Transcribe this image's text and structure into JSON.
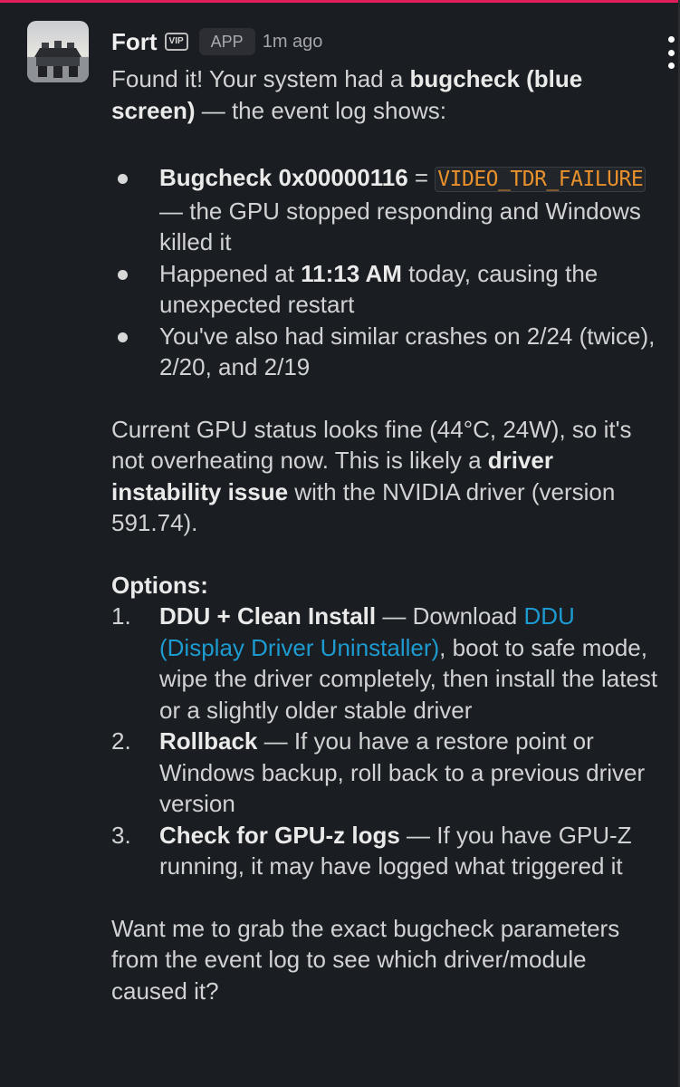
{
  "message": {
    "author": "Fort",
    "vip_badge": "VIP",
    "app_badge": "APP",
    "timestamp": "1m ago",
    "intro": {
      "prefix": "Found it! Your system had a ",
      "bold": "bugcheck (blue screen)",
      "suffix": " — the event log shows:"
    },
    "bullets": [
      {
        "bold": "Bugcheck 0x00000116",
        "text1": " = ",
        "code": "VIDEO_TDR_FAILURE",
        "text2": " — the GPU stopped responding and Windows killed it"
      },
      {
        "text1": "Happened at ",
        "bold": "11:13 AM",
        "text2": " today, causing the unexpected restart"
      },
      {
        "text": "You've also had similar crashes on 2/24 (twice), 2/20, and 2/19"
      }
    ],
    "status": {
      "text1": "Current GPU status looks fine (44°C, 24W), so it's not overheating now. This is likely a ",
      "bold": "driver instability issue",
      "text2": " with the NVIDIA driver (version 591.74)."
    },
    "options_heading": "Options:",
    "options": [
      {
        "number": "1.",
        "bold": "DDU + Clean Install",
        "text1": " — Download ",
        "link": "DDU (Display Driver Uninstaller)",
        "text2": ", boot to safe mode, wipe the driver completely, then install the latest or a slightly older stable driver"
      },
      {
        "number": "2.",
        "bold": "Rollback",
        "text1": " — If you have a restore point or Windows backup, roll back to a previous driver version"
      },
      {
        "number": "3.",
        "bold": "Check for GPU-z logs",
        "text1": " — If you have GPU-Z running, it may have logged what triggered it"
      }
    ],
    "closing": "Want me to grab the exact bugcheck parameters from the event log to see which driver/module caused it?"
  },
  "icons": {
    "avatar": "avatar-image",
    "menu": "more-vertical-icon"
  },
  "colors": {
    "background": "#1a1d21",
    "text": "#d1d2d3",
    "code": "#e8912d",
    "link": "#1d9bd1",
    "accent_line": "#e01e5a"
  }
}
